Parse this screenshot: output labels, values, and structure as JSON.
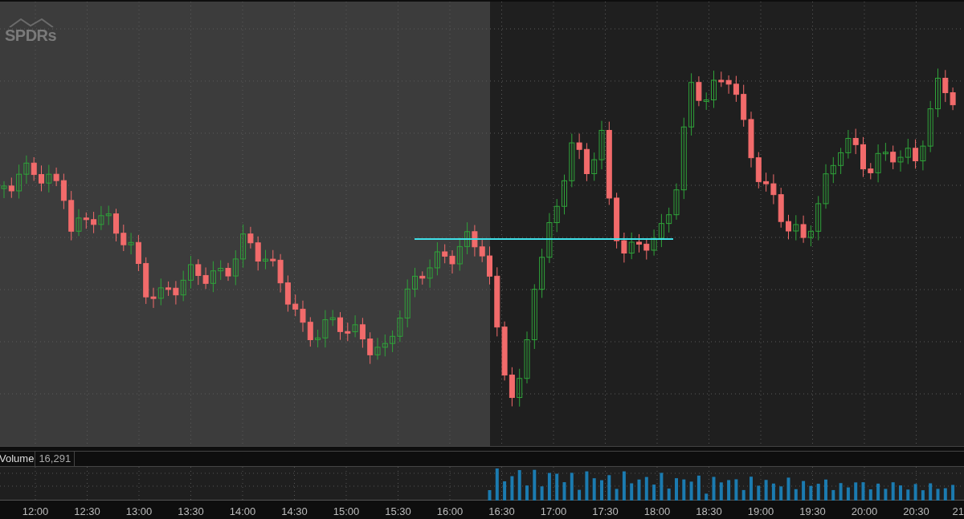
{
  "logo": {
    "text": "SPDRs"
  },
  "volume_panel": {
    "label": "Volume",
    "value": "16,291"
  },
  "time_axis": {
    "labels": [
      "12:00",
      "12:30",
      "13:00",
      "13:30",
      "14:00",
      "14:30",
      "15:00",
      "15:30",
      "16:00",
      "16:30",
      "17:00",
      "17:30",
      "18:00",
      "18:30",
      "19:00",
      "19:30",
      "20:00",
      "20:30",
      "21"
    ]
  }
}
